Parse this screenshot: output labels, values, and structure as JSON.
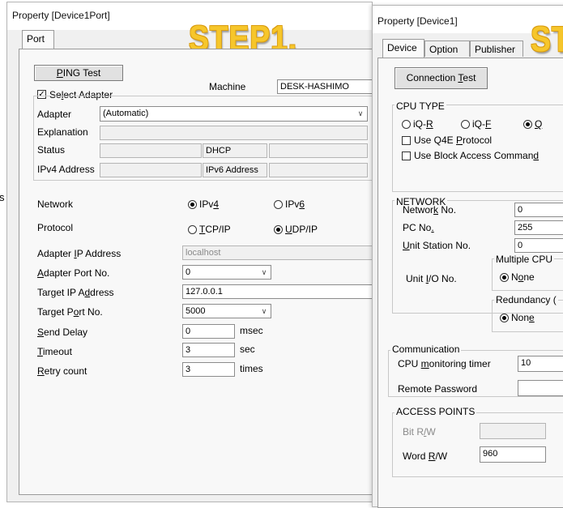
{
  "left_window": {
    "title": "Property [Device1Port]",
    "tab": "Port",
    "step_label": "STEP1.",
    "ping_button": "PING Test",
    "select_adapter_label": "Select Adapter",
    "select_adapter_checked": true,
    "machine_label": "Machine",
    "machine_value": "DESK-HASHIMO",
    "adapter_label": "Adapter",
    "adapter_value": "(Automatic)",
    "explanation_label": "Explanation",
    "status_label": "Status",
    "dhcp_label": "DHCP",
    "ipv4_address_label": "IPv4 Address",
    "ipv6_address_label": "IPv6 Address",
    "network_label": "Network",
    "network_options": [
      "IPv4",
      "IPv6"
    ],
    "network_selected": "IPv4",
    "protocol_label": "Protocol",
    "protocol_options": [
      "TCP/IP",
      "UDP/IP"
    ],
    "protocol_selected": "UDP/IP",
    "adapter_ip_label": "Adapter IP Address",
    "adapter_ip_value": "localhost",
    "adapter_port_label": "Adapter Port No.",
    "adapter_port_value": "0",
    "target_ip_label": "Target IP Address",
    "target_ip_value": "127.0.0.1",
    "target_port_label": "Target Port No.",
    "target_port_value": "5000",
    "send_delay_label": "Send Delay",
    "send_delay_value": "0",
    "send_delay_unit": "msec",
    "timeout_label": "Timeout",
    "timeout_value": "3",
    "timeout_unit": "sec",
    "retry_label": "Retry count",
    "retry_value": "3",
    "retry_unit": "times"
  },
  "right_window": {
    "title": "Property [Device1]",
    "tabs": [
      "Device",
      "Option",
      "Publisher"
    ],
    "step_label_partial": "ST",
    "connection_test_button": "Connection Test",
    "cpu_type_label": "CPU TYPE",
    "cpu_options": [
      "iQ-R",
      "iQ-F",
      "Q"
    ],
    "cpu_selected": "Q",
    "use_q4e_label": "Use Q4E Protocol",
    "use_block_access_label": "Use Block Access Command",
    "network_group_label": "NETWORK",
    "network_no_label": "Network No.",
    "network_no_value": "0",
    "pc_no_label": "PC No.",
    "pc_no_value": "255",
    "unit_station_label": "Unit Station No.",
    "unit_station_value": "0",
    "unit_io_label": "Unit I/O No.",
    "multiple_cpu_label": "Multiple CPU",
    "multiple_cpu_option": "None",
    "redundancy_label": "Redundancy (",
    "redundancy_option": "None",
    "communication_label": "Communication",
    "cpu_monitor_label": "CPU monitoring timer",
    "cpu_monitor_value": "10",
    "remote_password_label": "Remote Password",
    "access_points_label": "ACCESS POINTS",
    "bit_rw_label": "Bit R/W",
    "word_rw_label": "Word R/W",
    "word_rw_value": "960"
  },
  "left_edge_fragment": "s",
  "colors": {
    "step_yellow": "#f6c62b",
    "window_bg": "#f0f0f0",
    "panel_bg": "#f8f8f8"
  }
}
